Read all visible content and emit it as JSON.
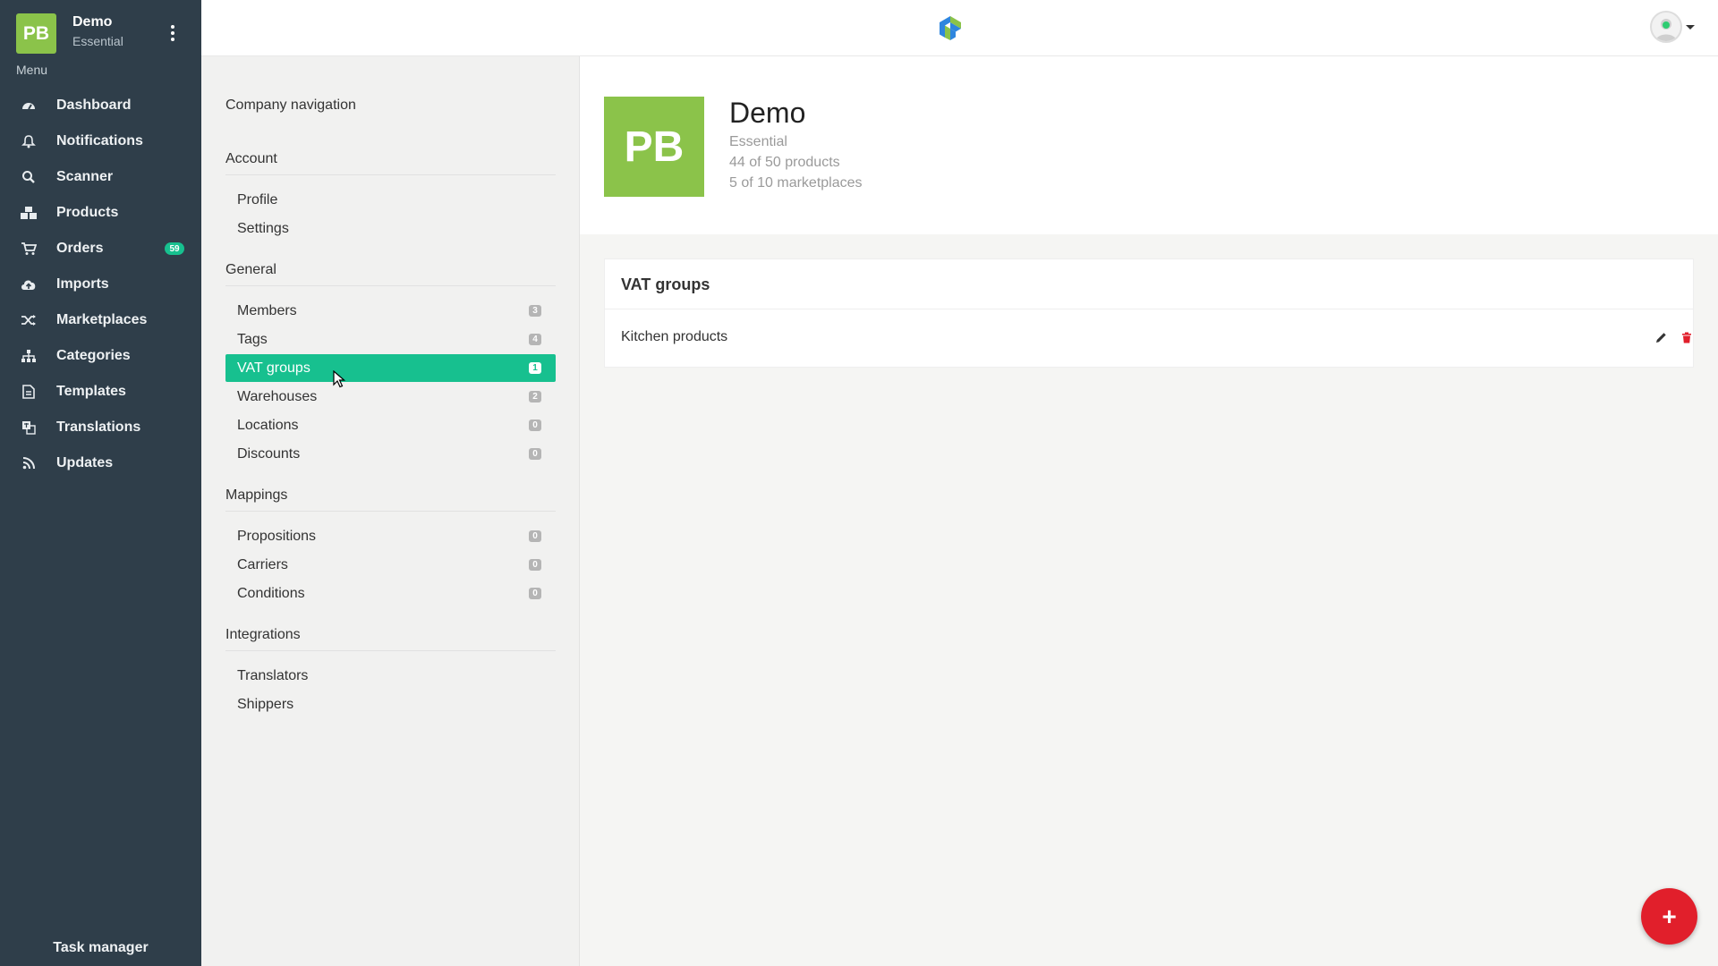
{
  "sidebar": {
    "avatar_initials": "PB",
    "company": "Demo",
    "plan": "Essential",
    "menu_label": "Menu",
    "items": [
      {
        "label": "Dashboard",
        "icon": "dashboard-icon"
      },
      {
        "label": "Notifications",
        "icon": "bell-icon"
      },
      {
        "label": "Scanner",
        "icon": "search-icon"
      },
      {
        "label": "Products",
        "icon": "cubes-icon"
      },
      {
        "label": "Orders",
        "icon": "cart-icon",
        "badge": "59"
      },
      {
        "label": "Imports",
        "icon": "cloud-upload-icon"
      },
      {
        "label": "Marketplaces",
        "icon": "shuffle-icon"
      },
      {
        "label": "Categories",
        "icon": "sitemap-icon"
      },
      {
        "label": "Templates",
        "icon": "file-icon"
      },
      {
        "label": "Translations",
        "icon": "translate-icon"
      },
      {
        "label": "Updates",
        "icon": "rss-icon"
      }
    ],
    "footer": "Task manager"
  },
  "company_nav": {
    "title": "Company navigation",
    "sections": [
      {
        "label": "Account",
        "items": [
          {
            "label": "Profile"
          },
          {
            "label": "Settings"
          }
        ]
      },
      {
        "label": "General",
        "items": [
          {
            "label": "Members",
            "count": "3"
          },
          {
            "label": "Tags",
            "count": "4"
          },
          {
            "label": "VAT groups",
            "count": "1",
            "active": true
          },
          {
            "label": "Warehouses",
            "count": "2"
          },
          {
            "label": "Locations",
            "count": "0"
          },
          {
            "label": "Discounts",
            "count": "0"
          }
        ]
      },
      {
        "label": "Mappings",
        "items": [
          {
            "label": "Propositions",
            "count": "0"
          },
          {
            "label": "Carriers",
            "count": "0"
          },
          {
            "label": "Conditions",
            "count": "0"
          }
        ]
      },
      {
        "label": "Integrations",
        "items": [
          {
            "label": "Translators"
          },
          {
            "label": "Shippers"
          }
        ]
      }
    ]
  },
  "company": {
    "initials": "PB",
    "name": "Demo",
    "plan": "Essential",
    "products": "44 of 50 products",
    "marketplaces": "5 of 10 marketplaces"
  },
  "vat_panel": {
    "title": "VAT groups",
    "rows": [
      {
        "name": "Kitchen products"
      }
    ]
  },
  "fab_label": "+",
  "colors": {
    "sidebar": "#2f3e4a",
    "accent": "#17c08f",
    "brand": "#8bc34a",
    "danger": "#e11f2b"
  }
}
